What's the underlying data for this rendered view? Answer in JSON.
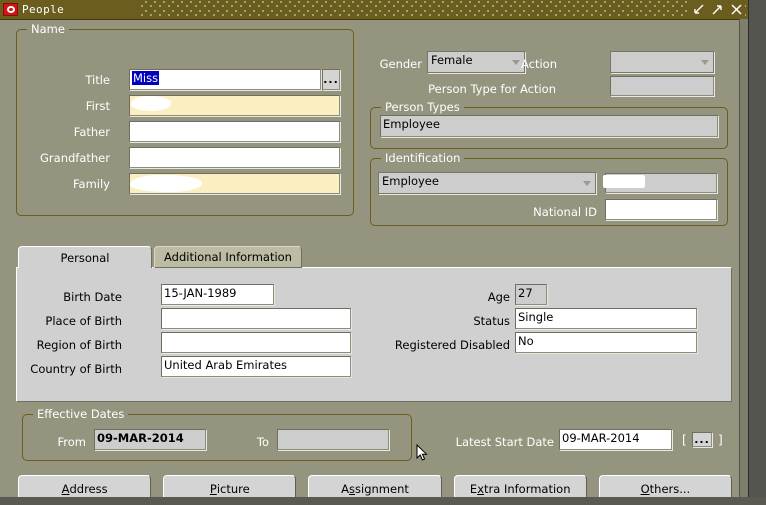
{
  "window": {
    "title": "People",
    "icon": "oracle-forms-icon",
    "buttons": {
      "minimize": "minimize-icon",
      "maximize": "maximize-icon",
      "close": "close-icon"
    }
  },
  "name_group": {
    "caption": "Name",
    "fields": [
      {
        "label": "Title",
        "value": "Miss",
        "selected": true,
        "required": false,
        "redacted": false,
        "lov": "..."
      },
      {
        "label": "First",
        "value": "",
        "selected": false,
        "required": true,
        "redacted": true
      },
      {
        "label": "Father",
        "value": "",
        "selected": false,
        "required": false,
        "redacted": false
      },
      {
        "label": "Grandfather",
        "value": "",
        "selected": false,
        "required": false,
        "redacted": false
      },
      {
        "label": "Family",
        "value": "",
        "selected": false,
        "required": true,
        "redacted": true
      }
    ]
  },
  "top_right": {
    "gender_label": "Gender",
    "gender_value": "Female",
    "action_label": "Action",
    "action_value": "",
    "person_type_for_action_label": "Person Type for Action",
    "person_type_for_action_value": ""
  },
  "person_types_group": {
    "caption": "Person Types",
    "value": "Employee"
  },
  "identification_group": {
    "caption": "Identification",
    "type_value": "Employee",
    "number_value": "",
    "national_id_label": "National ID",
    "national_id_value": ""
  },
  "tabs": [
    {
      "label": "Personal",
      "active": true
    },
    {
      "label": "Additional Information",
      "active": false
    }
  ],
  "personal_tab": {
    "left_fields": [
      {
        "label": "Birth Date",
        "value": "15-JAN-1989"
      },
      {
        "label": "Place of Birth",
        "value": ""
      },
      {
        "label": "Region of Birth",
        "value": ""
      },
      {
        "label": "Country of Birth",
        "value": "United Arab Emirates"
      }
    ],
    "right_fields": [
      {
        "label": "Age",
        "value": "27",
        "disabled": true
      },
      {
        "label": "Status",
        "value": "Single",
        "disabled": false
      },
      {
        "label": "Registered Disabled",
        "value": "No",
        "disabled": false
      }
    ]
  },
  "effective_dates": {
    "caption": "Effective Dates",
    "from_label": "From",
    "from_value": "09-MAR-2014",
    "to_label": "To",
    "to_value": ""
  },
  "latest_start_date": {
    "label": "Latest Start Date",
    "value": "09-MAR-2014",
    "bracket_open": "[",
    "bracket_close": "]",
    "lov": "..."
  },
  "bottom_buttons": [
    {
      "label": "Address",
      "accel": "A"
    },
    {
      "label": "Picture",
      "accel": "P"
    },
    {
      "label": "Assignment",
      "accel": "s"
    },
    {
      "label": "Extra Information",
      "accel": "x"
    },
    {
      "label": "Others...",
      "accel": "O"
    }
  ],
  "colors": {
    "window_bg": "#94947f",
    "titlebar": "#6b5d1e",
    "required_field": "#fbeec1",
    "selection": "#0000bf",
    "tab_panel": "#d0d0d0",
    "tab_inactive": "#bdbca2",
    "group_border": "#6b5d1e"
  }
}
